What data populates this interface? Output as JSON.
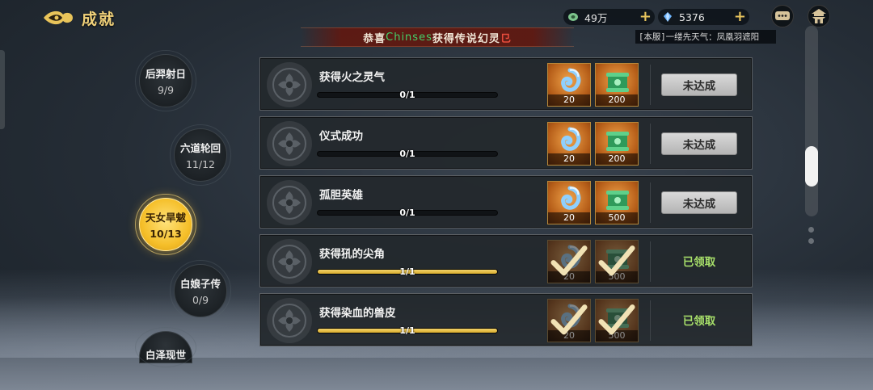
{
  "header": {
    "title": "成就"
  },
  "resources": [
    {
      "icon": "jade-coin-icon",
      "value": "49万",
      "color": "#7dc48c"
    },
    {
      "icon": "blue-crystal-icon",
      "value": "5376",
      "color": "#6fb7ff"
    }
  ],
  "banner": {
    "prefix": "恭喜",
    "player": "Chinses",
    "message": "获得传说幻灵",
    "tail": "⺋"
  },
  "server_notice": "[本服]一缕先天气：凤凰羽遮阳",
  "tags": [
    {
      "name": "后羿射日",
      "count": "9/9"
    },
    {
      "name": "六道轮回",
      "count": "11/12"
    },
    {
      "name": "天女旱魃",
      "count": "10/13",
      "active": true
    },
    {
      "name": "白娘子传",
      "count": "0/9"
    },
    {
      "name": "白泽现世",
      "count": ""
    }
  ],
  "achievements": [
    {
      "name": "获得火之灵气",
      "progress": "0/1",
      "fill": 0,
      "rewards": [
        {
          "type": "blue-swirl",
          "qty": "20"
        },
        {
          "type": "green-scroll",
          "qty": "200"
        }
      ],
      "action": "未达成",
      "claimed": false
    },
    {
      "name": "仪式成功",
      "progress": "0/1",
      "fill": 0,
      "rewards": [
        {
          "type": "blue-swirl",
          "qty": "20"
        },
        {
          "type": "green-scroll",
          "qty": "200"
        }
      ],
      "action": "未达成",
      "claimed": false
    },
    {
      "name": "孤胆英雄",
      "progress": "0/1",
      "fill": 0,
      "rewards": [
        {
          "type": "blue-swirl",
          "qty": "20"
        },
        {
          "type": "green-scroll",
          "qty": "500"
        }
      ],
      "action": "未达成",
      "claimed": false
    },
    {
      "name": "获得犼的尖角",
      "progress": "1/1",
      "fill": 1,
      "rewards": [
        {
          "type": "blue-swirl",
          "qty": "20"
        },
        {
          "type": "green-scroll",
          "qty": "500"
        }
      ],
      "action": "已领取",
      "claimed": true
    },
    {
      "name": "获得染血的兽皮",
      "progress": "1/1",
      "fill": 1,
      "rewards": [
        {
          "type": "blue-swirl",
          "qty": "20"
        },
        {
          "type": "green-scroll",
          "qty": "500"
        }
      ],
      "action": "已领取",
      "claimed": true
    }
  ],
  "scrollbar": {
    "position": 0.8
  }
}
